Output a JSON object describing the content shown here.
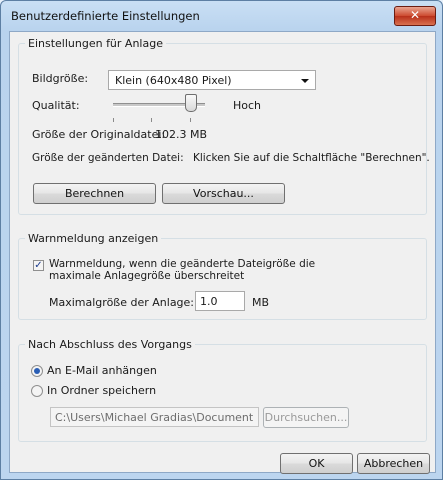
{
  "window": {
    "title": "Benutzerdefinierte Einstellungen",
    "close_glyph": "✕"
  },
  "attachment_settings": {
    "legend": "Einstellungen für Anlage",
    "image_size_label": "Bildgröße:",
    "image_size_value": "Klein (640x480 Pixel)",
    "quality_label": "Qualität:",
    "quality_value_label": "Hoch",
    "quality_level": 0.85,
    "original_size_label": "Größe der Originaldatei:",
    "original_size_value": "102.3 MB",
    "changed_size_label": "Größe der geänderten Datei:",
    "changed_size_value": "Klicken Sie auf die Schaltfläche \"Berechnen\".",
    "calculate_button": "Berechnen",
    "preview_button": "Vorschau..."
  },
  "warning": {
    "legend": "Warnmeldung anzeigen",
    "checkbox_checked": true,
    "checkbox_label_line1": "Warnmeldung, wenn die geänderte Dateigröße die",
    "checkbox_label_line2": "maximale Anlagegröße überschreitet",
    "max_size_label": "Maximalgröße der Anlage:",
    "max_size_value": "1.0",
    "max_size_unit": "MB"
  },
  "after_completion": {
    "legend": "Nach Abschluss des Vorgangs",
    "option_attach": "An E-Mail anhängen",
    "option_save": "In Ordner speichern",
    "selected": "attach",
    "folder_path": "C:\\Users\\Michael Gradias\\Document",
    "browse_button": "Durchsuchen..."
  },
  "footer": {
    "ok_button": "OK",
    "cancel_button": "Abbrechen"
  },
  "icons": {
    "checkmark": "✓",
    "dropdown": "chevron-down-icon"
  }
}
